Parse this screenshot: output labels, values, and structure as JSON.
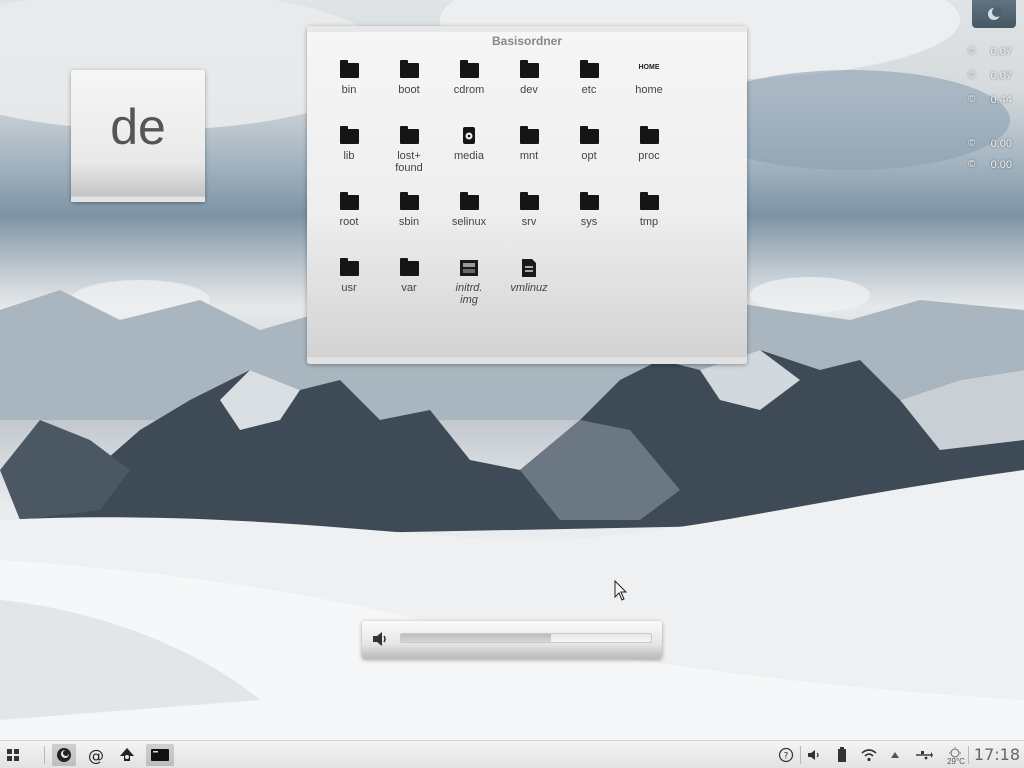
{
  "keyboard_layout": {
    "label": "de"
  },
  "folder_view": {
    "title": "Basisordner",
    "items": [
      {
        "label": "bin",
        "icon": "folder-icon"
      },
      {
        "label": "boot",
        "icon": "folder-icon"
      },
      {
        "label": "cdrom",
        "icon": "folder-icon"
      },
      {
        "label": "dev",
        "icon": "folder-icon"
      },
      {
        "label": "etc",
        "icon": "folder-icon"
      },
      {
        "label": "home",
        "icon": "home-folder-icon",
        "icon_text": "HOME"
      },
      {
        "label": "lib",
        "icon": "folder-icon"
      },
      {
        "label": "lost+\nfound",
        "icon": "folder-icon"
      },
      {
        "label": "media",
        "icon": "media-folder-icon"
      },
      {
        "label": "mnt",
        "icon": "folder-icon"
      },
      {
        "label": "opt",
        "icon": "folder-icon"
      },
      {
        "label": "proc",
        "icon": "folder-icon"
      },
      {
        "label": "root",
        "icon": "folder-icon"
      },
      {
        "label": "sbin",
        "icon": "folder-icon"
      },
      {
        "label": "selinux",
        "icon": "folder-icon"
      },
      {
        "label": "srv",
        "icon": "folder-icon"
      },
      {
        "label": "sys",
        "icon": "folder-icon"
      },
      {
        "label": "tmp",
        "icon": "folder-icon"
      },
      {
        "label": "usr",
        "icon": "folder-icon"
      },
      {
        "label": "var",
        "icon": "folder-icon"
      },
      {
        "label": "initrd.\nimg",
        "icon": "image-file-icon",
        "italic": true
      },
      {
        "label": "vmlinuz",
        "icon": "file-icon",
        "italic": true
      }
    ]
  },
  "system_monitor": {
    "rows": [
      {
        "icon": "cpu-icon",
        "value": "0.07"
      },
      {
        "icon": "cpu-icon",
        "value": "0.07"
      },
      {
        "icon": "memory-icon",
        "value": "0.44"
      },
      {
        "icon": "network-down-icon",
        "value": "0.00"
      },
      {
        "icon": "network-up-icon",
        "value": "0.00"
      }
    ]
  },
  "volume_osd": {
    "level": 0.6
  },
  "taskbar": {
    "launchers": [
      {
        "name": "application-launcher",
        "icon": "grid-icon",
        "active": false
      },
      {
        "name": "firefox",
        "icon": "firefox-icon",
        "active": true
      },
      {
        "name": "mail",
        "icon": "mail-at-icon",
        "active": false
      },
      {
        "name": "inkscape",
        "icon": "inkscape-icon",
        "active": false
      },
      {
        "name": "terminal",
        "icon": "terminal-icon",
        "active": true
      }
    ],
    "tray": [
      "help-icon",
      "volume-icon",
      "battery-icon",
      "wifi-icon",
      "up-arrow-icon",
      "usb-icon",
      "weather-icon"
    ],
    "weather_temp": "29°C",
    "clock": "17:18"
  }
}
